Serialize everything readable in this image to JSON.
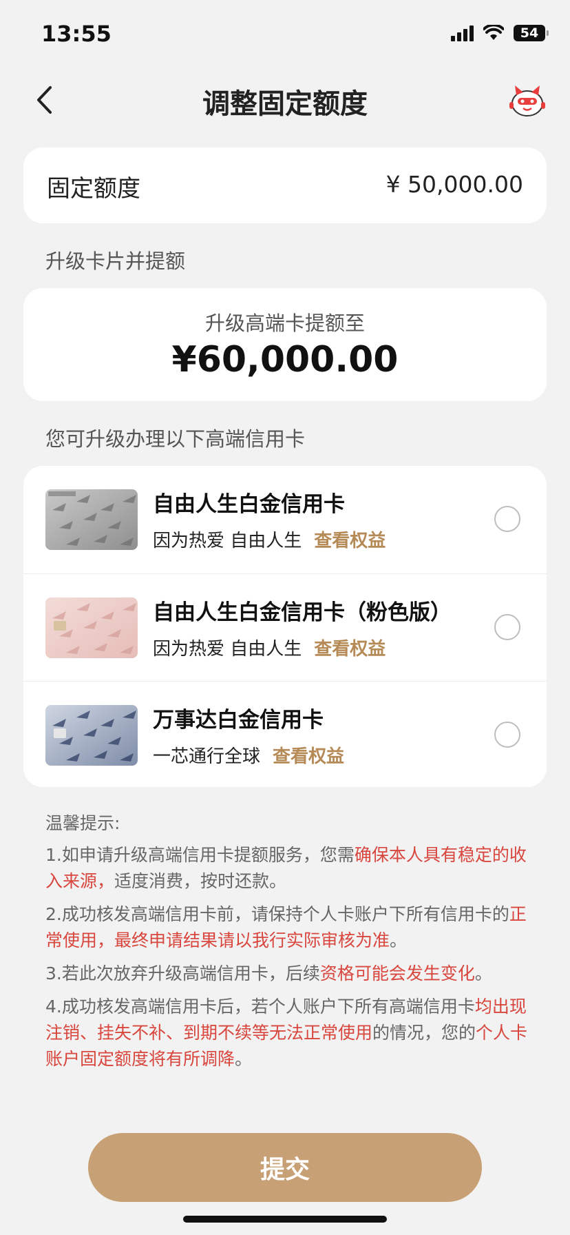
{
  "status": {
    "time": "13:55",
    "battery": "54"
  },
  "header": {
    "title": "调整固定额度"
  },
  "fixed_limit": {
    "label": "固定额度",
    "value": "¥ 50,000.00"
  },
  "upgrade_section": {
    "title": "升级卡片并提额",
    "subtitle": "升级高端卡提额至",
    "amount": "¥60,000.00"
  },
  "card_list": {
    "title": "您可升级办理以下高端信用卡",
    "cards": [
      {
        "name": "自由人生白金信用卡",
        "desc": "因为热爱 自由人生",
        "link": "查看权益",
        "selected": false
      },
      {
        "name": "自由人生白金信用卡（粉色版）",
        "desc": "因为热爱 自由人生",
        "link": "查看权益",
        "selected": false
      },
      {
        "name": "万事达白金信用卡",
        "desc": "一芯通行全球",
        "link": "查看权益",
        "selected": false
      }
    ]
  },
  "tips": {
    "title": "温馨提示:",
    "items": [
      {
        "parts": [
          {
            "text": "1.如申请升级高端信用卡提额服务，您需",
            "highlight": false
          },
          {
            "text": "确保本人具有稳定的收入来源，",
            "highlight": true
          },
          {
            "text": "适度消费，按时还款。",
            "highlight": false
          }
        ]
      },
      {
        "parts": [
          {
            "text": "2.成功核发高端信用卡前，请保持个人卡账户下所有信用卡的",
            "highlight": false
          },
          {
            "text": "正常使用，最终申请结果请以我行实际审核为准",
            "highlight": true
          },
          {
            "text": "。",
            "highlight": false
          }
        ]
      },
      {
        "parts": [
          {
            "text": "3.若此次放弃升级高端信用卡，后续",
            "highlight": false
          },
          {
            "text": "资格可能会发生变化",
            "highlight": true
          },
          {
            "text": "。",
            "highlight": false
          }
        ]
      },
      {
        "parts": [
          {
            "text": "4.成功核发高端信用卡后，若个人账户下所有高端信用卡",
            "highlight": false
          },
          {
            "text": "均出现注销、挂失不补、到期不续等无法正常使用",
            "highlight": true
          },
          {
            "text": "的情况，您的",
            "highlight": false
          },
          {
            "text": "个人卡账户固定额度将有所调降",
            "highlight": true
          },
          {
            "text": "。",
            "highlight": false
          }
        ]
      }
    ]
  },
  "submit": {
    "label": "提交"
  },
  "colors": {
    "accent": "#c8a075",
    "link": "#b58a56",
    "warning": "#d8463d",
    "background": "#f2f2f2"
  }
}
